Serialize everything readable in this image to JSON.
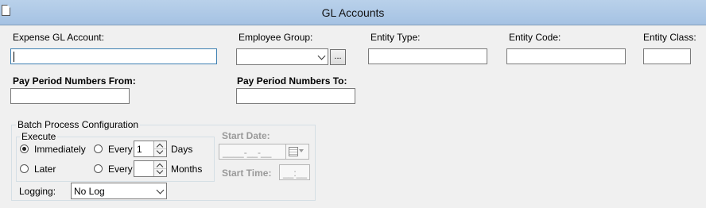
{
  "window": {
    "title": "GL Accounts"
  },
  "fields": {
    "expense_gl_account": {
      "label": "Expense GL Account:",
      "value": ""
    },
    "employee_group": {
      "label": "Employee Group:",
      "value": "",
      "browse_label": "..."
    },
    "entity_type": {
      "label": "Entity Type:",
      "value": ""
    },
    "entity_code": {
      "label": "Entity Code:",
      "value": ""
    },
    "entity_class": {
      "label": "Entity Class:",
      "value": ""
    },
    "pay_period_from": {
      "label": "Pay Period Numbers From:",
      "value": ""
    },
    "pay_period_to": {
      "label": "Pay Period Numbers To:",
      "value": ""
    }
  },
  "batch": {
    "legend": "Batch Process Configuration",
    "execute": {
      "legend": "Execute",
      "immediately": "Immediately",
      "later": "Later",
      "every1": "Every",
      "every2": "Every",
      "days_value": "1",
      "days_label": "Days",
      "months_value": "",
      "months_label": "Months",
      "selected": "immediately"
    },
    "start_date": {
      "label": "Start Date:",
      "value": "____-__-__"
    },
    "start_time": {
      "label": "Start Time:",
      "value": "__:__"
    },
    "logging": {
      "label": "Logging:",
      "value": "No Log"
    }
  }
}
